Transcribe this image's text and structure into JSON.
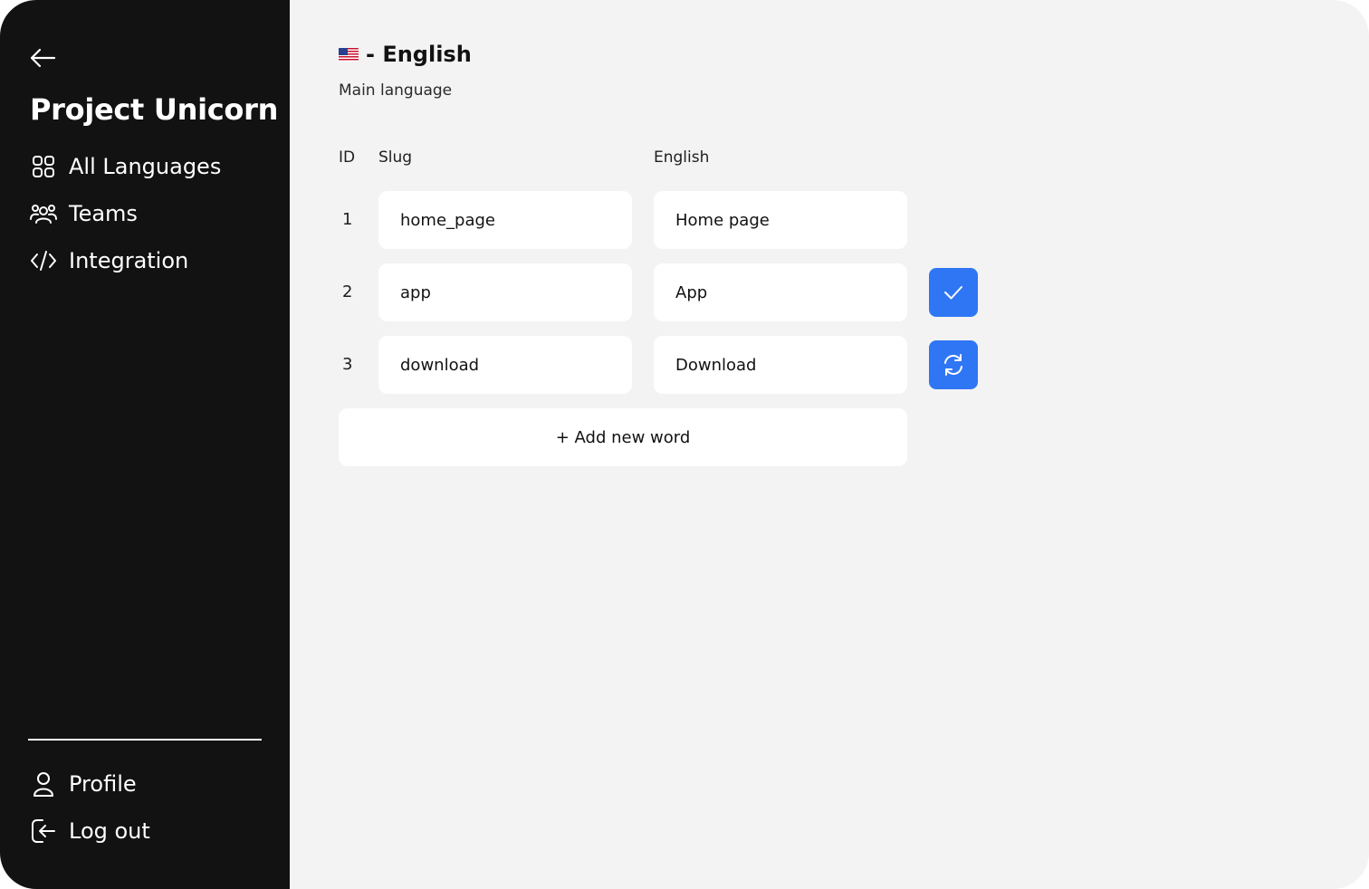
{
  "sidebar": {
    "back_icon": "arrow-left-icon",
    "project_title": "Project Unicorn",
    "nav_items": [
      {
        "label": "All Languages",
        "icon": "grid-icon"
      },
      {
        "label": "Teams",
        "icon": "users-icon"
      },
      {
        "label": "Integration",
        "icon": "code-icon"
      }
    ],
    "bottom_items": [
      {
        "label": "Profile",
        "icon": "user-icon"
      },
      {
        "label": "Log out",
        "icon": "logout-icon"
      }
    ]
  },
  "main": {
    "language": {
      "flag_icon": "us-flag-icon",
      "title": "- English",
      "subtitle": "Main language"
    },
    "table": {
      "headers": {
        "id": "ID",
        "slug": "Slug",
        "translation": "English"
      },
      "rows": [
        {
          "id": "1",
          "slug": "home_page",
          "translation": "Home page",
          "action": null
        },
        {
          "id": "2",
          "slug": "app",
          "translation": "App",
          "action": "check-icon"
        },
        {
          "id": "3",
          "slug": "download",
          "translation": "Download",
          "action": "refresh-icon"
        }
      ]
    },
    "add_word_label": "+ Add new word"
  },
  "colors": {
    "sidebar_bg": "#121212",
    "main_bg": "#f3f3f3",
    "accent": "#2f76f5"
  }
}
